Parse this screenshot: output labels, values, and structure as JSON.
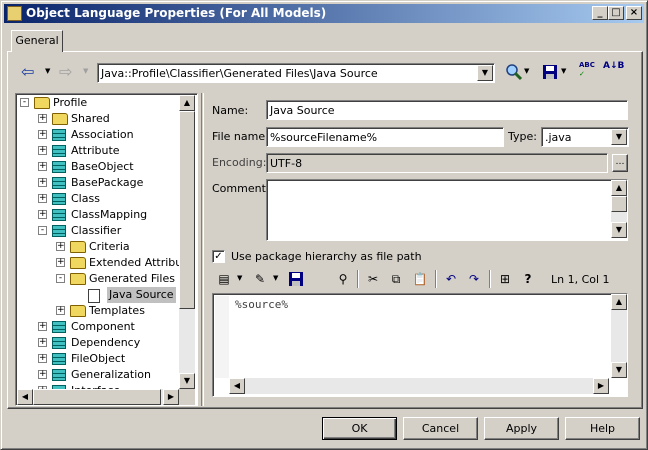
{
  "window": {
    "title": "Object Language Properties (For All Models)",
    "min": "_",
    "max": "□",
    "close": "×"
  },
  "tabs": [
    {
      "label": "General"
    }
  ],
  "toolbar": {
    "back": "⇦",
    "forward": "⇨",
    "path": "Java::Profile\\Classifier\\Generated Files\\Java Source",
    "abc_label": "ABC",
    "sort_label": "A↓B"
  },
  "tree": {
    "items": [
      {
        "label": "Profile",
        "icon": "folder-icon"
      },
      {
        "label": "Shared",
        "icon": "folder-icon"
      },
      {
        "label": "Association",
        "icon": "class-icon"
      },
      {
        "label": "Attribute",
        "icon": "class-icon"
      },
      {
        "label": "BaseObject",
        "icon": "class-icon"
      },
      {
        "label": "BasePackage",
        "icon": "class-icon"
      },
      {
        "label": "Class",
        "icon": "class-icon"
      },
      {
        "label": "ClassMapping",
        "icon": "class-icon"
      },
      {
        "label": "Classifier",
        "icon": "class-icon"
      },
      {
        "label": "Criteria",
        "icon": "folder-icon"
      },
      {
        "label": "Extended Attribute",
        "icon": "folder-icon"
      },
      {
        "label": "Generated Files",
        "icon": "folder-icon"
      },
      {
        "label": "Java Source",
        "icon": "document-icon"
      },
      {
        "label": "Templates",
        "icon": "folder-icon"
      },
      {
        "label": "Component",
        "icon": "class-icon"
      },
      {
        "label": "Dependency",
        "icon": "class-icon"
      },
      {
        "label": "FileObject",
        "icon": "class-icon"
      },
      {
        "label": "Generalization",
        "icon": "class-icon"
      },
      {
        "label": "Interface",
        "icon": "class-icon"
      }
    ]
  },
  "form": {
    "name_label": "Name:",
    "name_value": "Java Source",
    "filename_label": "File name:",
    "filename_value": "%sourceFilename%",
    "type_label": "Type:",
    "type_value": ".java",
    "encoding_label": "Encoding:",
    "encoding_value": "UTF-8",
    "comment_label": "Comment:",
    "comment_value": "",
    "checkbox_label": "Use package hierarchy as file path",
    "checkbox_checked": true,
    "cursor_pos": "Ln 1, Col 1",
    "editor_text": "%source%"
  },
  "buttons": {
    "ok": "OK",
    "cancel": "Cancel",
    "apply": "Apply",
    "help": "Help"
  }
}
